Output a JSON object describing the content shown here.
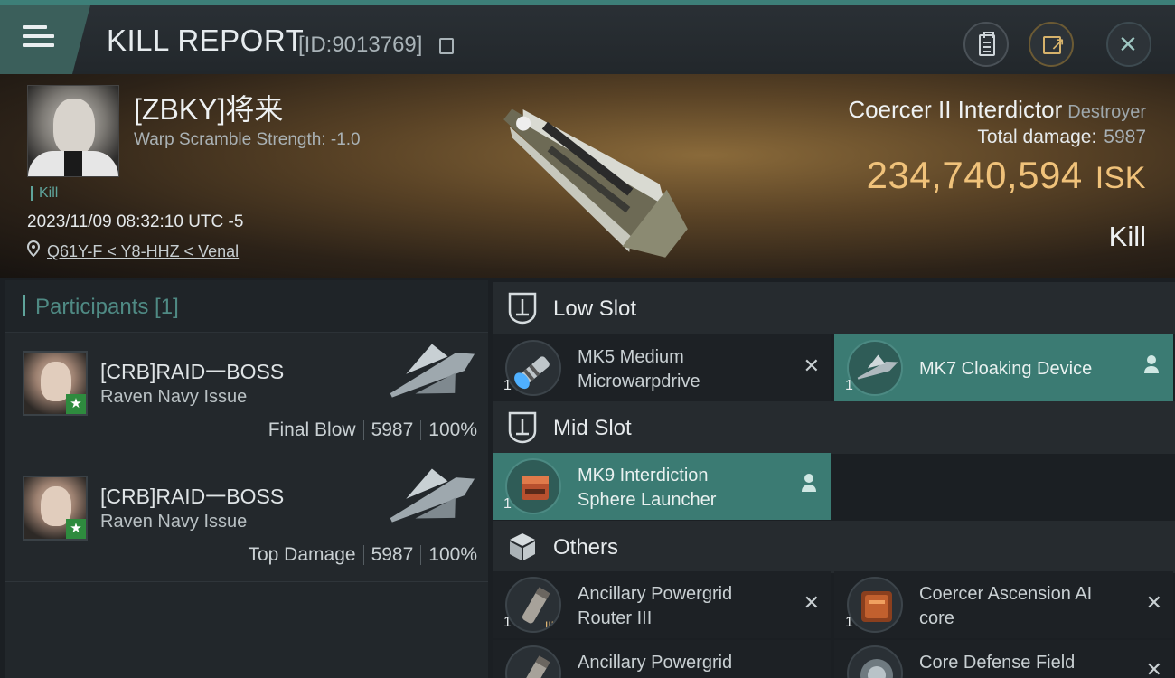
{
  "header": {
    "title": "KILL REPORT",
    "report_id": "[ID:9013769]",
    "icons": [
      "menu-icon",
      "copy-icon",
      "clipboard-icon",
      "share-icon",
      "close-icon"
    ]
  },
  "victim": {
    "name": "[ZBKY]将来",
    "warp_scramble": "Warp Scramble Strength: -1.0",
    "kill_tag": "Kill",
    "timestamp": "2023/11/09 08:32:10 UTC -5",
    "location": "Q61Y-F < Y8-HHZ < Venal",
    "ship": "Coercer II Interdictor",
    "ship_class": "Destroyer",
    "total_damage_label": "Total damage:",
    "total_damage": "5987",
    "isk_value": "234,740,594",
    "isk_unit": "ISK",
    "kill_type": "Kill"
  },
  "participants": {
    "label": "Participants [1]",
    "rows": [
      {
        "name": "[CRB]RAID一BOSS",
        "ship": "Raven Navy Issue",
        "role": "Final Blow",
        "damage": "5987",
        "percent": "100%"
      },
      {
        "name": "[CRB]RAID一BOSS",
        "ship": "Raven Navy Issue",
        "role": "Top Damage",
        "damage": "5987",
        "percent": "100%"
      }
    ]
  },
  "slots": {
    "low": {
      "label": "Low Slot",
      "modules": [
        {
          "qty": "1",
          "line1": "MK5 Medium",
          "line2": "Microwarpdrive",
          "state": "destroyed"
        },
        {
          "qty": "1",
          "line1": "MK7 Cloaking Device",
          "line2": "",
          "state": "dropped"
        }
      ]
    },
    "mid": {
      "label": "Mid Slot",
      "modules": [
        {
          "qty": "1",
          "line1": "MK9 Interdiction",
          "line2": "Sphere Launcher",
          "state": "dropped"
        }
      ]
    },
    "others": {
      "label": "Others",
      "modules": [
        {
          "qty": "1",
          "line1": "Ancillary Powergrid",
          "line2": "Router III",
          "state": "destroyed"
        },
        {
          "qty": "1",
          "line1": "Coercer Ascension AI",
          "line2": "core",
          "state": "destroyed"
        },
        {
          "qty": "",
          "line1": "Ancillary Powergrid",
          "line2": "",
          "state": "destroyed"
        },
        {
          "qty": "",
          "line1": "Core Defense Field",
          "line2": "",
          "state": "destroyed"
        }
      ]
    }
  },
  "colors": {
    "accent": "#3b7b73",
    "isk": "#f0c27a",
    "header_top": "#3d7f78"
  }
}
